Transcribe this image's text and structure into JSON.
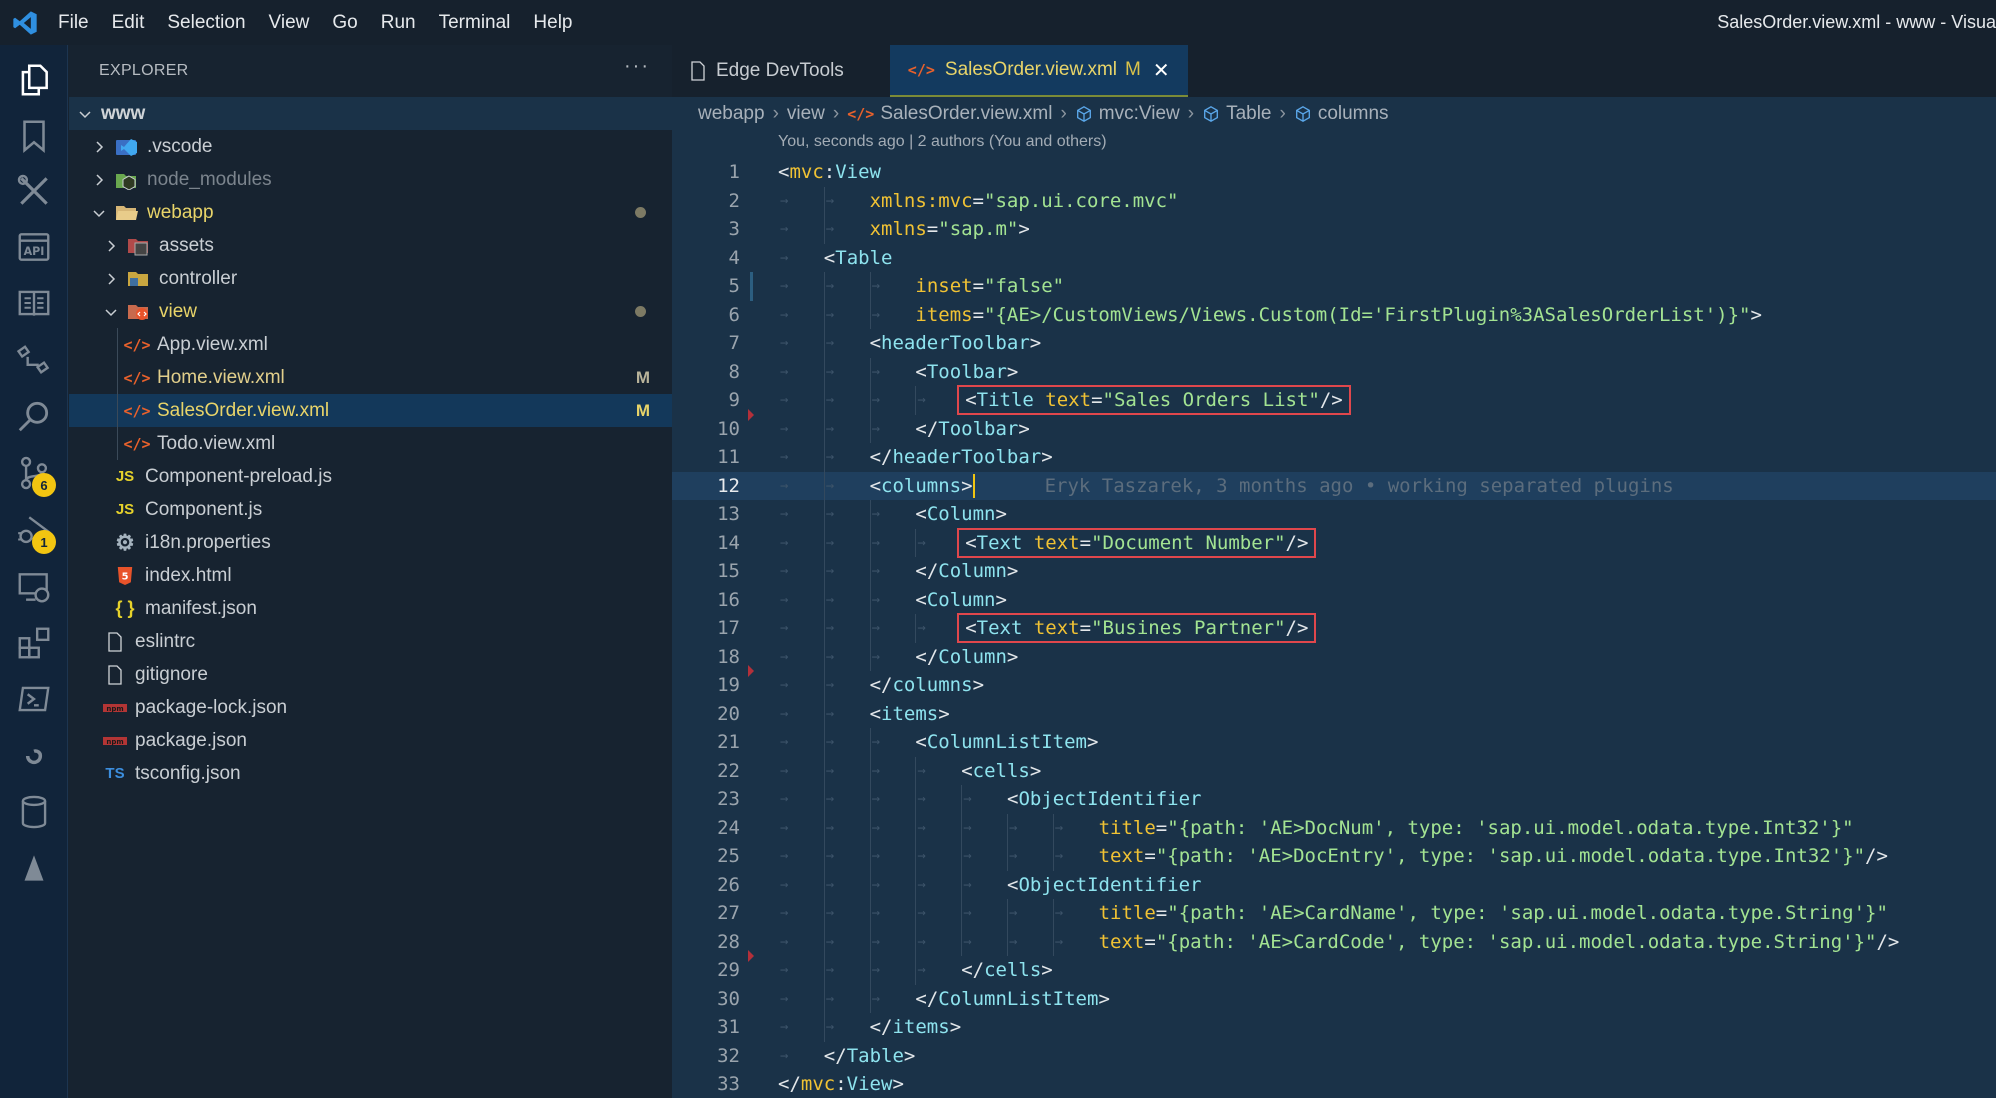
{
  "window": {
    "title": "SalesOrder.view.xml - www - Visual Studio Code",
    "title_visible": "SalesOrder.view.xml - www - Visua",
    "menu": [
      "File",
      "Edit",
      "Selection",
      "View",
      "Go",
      "Run",
      "Terminal",
      "Help"
    ]
  },
  "activity_bar": {
    "items": [
      {
        "name": "explorer",
        "icon": "files-icon",
        "active": true
      },
      {
        "name": "bookmarks",
        "icon": "bookmark-icon"
      },
      {
        "name": "sap-tools",
        "icon": "tools-icon"
      },
      {
        "name": "api",
        "icon": "api-icon"
      },
      {
        "name": "docs",
        "icon": "book-icon"
      },
      {
        "name": "remote-explorer",
        "icon": "remote-icon"
      },
      {
        "name": "search",
        "icon": "search-icon"
      },
      {
        "name": "source-control",
        "icon": "source-control-icon",
        "badge": "6"
      },
      {
        "name": "run-debug",
        "icon": "run-debug-icon",
        "badge": "1"
      },
      {
        "name": "remote-desktop",
        "icon": "remote-desktop-icon"
      },
      {
        "name": "extensions",
        "icon": "extensions-icon"
      },
      {
        "name": "powershell",
        "icon": "terminal-icon"
      },
      {
        "name": "swirl",
        "icon": "swirl-icon"
      },
      {
        "name": "database",
        "icon": "database-icon"
      },
      {
        "name": "azure",
        "icon": "azure-icon"
      }
    ]
  },
  "explorer": {
    "title": "EXPLORER",
    "more": "···",
    "root": "www",
    "items": [
      {
        "label": ".vscode",
        "type": "folder",
        "collapsed": true,
        "depth": 1,
        "icon": "vscode-folder-icon"
      },
      {
        "label": "node_modules",
        "type": "folder",
        "collapsed": true,
        "depth": 1,
        "icon": "node-folder-icon",
        "dim": true
      },
      {
        "label": "webapp",
        "type": "folder",
        "collapsed": false,
        "depth": 1,
        "icon": "folder-open-icon",
        "dot": true,
        "modified_color": true
      },
      {
        "label": "assets",
        "type": "folder",
        "collapsed": true,
        "depth": 2,
        "icon": "assets-folder-icon"
      },
      {
        "label": "controller",
        "type": "folder",
        "collapsed": true,
        "depth": 2,
        "icon": "controller-folder-icon"
      },
      {
        "label": "view",
        "type": "folder",
        "collapsed": false,
        "depth": 2,
        "icon": "view-folder-icon",
        "dot": true,
        "modified_color": true
      },
      {
        "label": "App.view.xml",
        "type": "file",
        "depth": 3,
        "icon": "xml-icon"
      },
      {
        "label": "Home.view.xml",
        "type": "file",
        "depth": 3,
        "icon": "xml-icon",
        "status": "M"
      },
      {
        "label": "SalesOrder.view.xml",
        "type": "file",
        "depth": 3,
        "icon": "xml-icon",
        "status": "M",
        "selected": true
      },
      {
        "label": "Todo.view.xml",
        "type": "file",
        "depth": 3,
        "icon": "xml-icon"
      },
      {
        "label": "Component-preload.js",
        "type": "file",
        "depth": 2,
        "icon": "js-icon"
      },
      {
        "label": "Component.js",
        "type": "file",
        "depth": 2,
        "icon": "js-icon"
      },
      {
        "label": "i18n.properties",
        "type": "file",
        "depth": 2,
        "icon": "gear-icon"
      },
      {
        "label": "index.html",
        "type": "file",
        "depth": 2,
        "icon": "html5-icon"
      },
      {
        "label": "manifest.json",
        "type": "file",
        "depth": 2,
        "icon": "json-icon"
      },
      {
        "label": "eslintrc",
        "type": "file",
        "depth": 1,
        "icon": "file-icon"
      },
      {
        "label": "gitignore",
        "type": "file",
        "depth": 1,
        "icon": "file-icon"
      },
      {
        "label": "package-lock.json",
        "type": "file",
        "depth": 1,
        "icon": "npm-icon"
      },
      {
        "label": "package.json",
        "type": "file",
        "depth": 1,
        "icon": "npm-icon"
      },
      {
        "label": "tsconfig.json",
        "type": "file",
        "depth": 1,
        "icon": "tsconfig-icon"
      }
    ]
  },
  "tabs": [
    {
      "label": "Edge DevTools",
      "icon": "file-icon",
      "active": false
    },
    {
      "label": "SalesOrder.view.xml",
      "icon": "xml-icon",
      "active": true,
      "status": "M",
      "close": "✕"
    }
  ],
  "breadcrumb": [
    {
      "label": "webapp"
    },
    {
      "label": "view"
    },
    {
      "label": "SalesOrder.view.xml",
      "icon": "xml-icon"
    },
    {
      "label": "mvc:View",
      "icon": "symbol-icon"
    },
    {
      "label": "Table",
      "icon": "symbol-icon"
    },
    {
      "label": "columns",
      "icon": "symbol-icon"
    }
  ],
  "codelens": "You, seconds ago | 2 authors (You and others)",
  "editor": {
    "current_line": 12,
    "blame": "Eryk Taszarek, 3 months ago • working separated plugins",
    "lines": [
      {
        "n": "1",
        "indent": 0,
        "tokens": [
          [
            "p",
            "<"
          ],
          [
            "ns",
            "mvc"
          ],
          [
            "p",
            ":"
          ],
          [
            "tag",
            "View"
          ]
        ]
      },
      {
        "n": "2",
        "indent": 2,
        "tokens": [
          [
            "attr",
            "xmlns:mvc"
          ],
          [
            "p",
            "="
          ],
          [
            "str",
            "\"sap.ui.core.mvc\""
          ]
        ]
      },
      {
        "n": "3",
        "indent": 2,
        "tokens": [
          [
            "attr",
            "xmlns"
          ],
          [
            "p",
            "="
          ],
          [
            "str",
            "\"sap.m\""
          ],
          [
            "p",
            ">"
          ]
        ]
      },
      {
        "n": "4",
        "indent": 1,
        "tokens": [
          [
            "p",
            "<"
          ],
          [
            "tag",
            "Table"
          ]
        ]
      },
      {
        "n": "5",
        "indent": 3,
        "tokens": [
          [
            "attr",
            "inset"
          ],
          [
            "p",
            "="
          ],
          [
            "str",
            "\"false\""
          ]
        ]
      },
      {
        "n": "6",
        "indent": 3,
        "tokens": [
          [
            "attr",
            "items"
          ],
          [
            "p",
            "="
          ],
          [
            "str",
            "\"{AE>/CustomViews/Views.Custom(Id='FirstPlugin%3ASalesOrderList')}\""
          ],
          [
            "p",
            ">"
          ]
        ]
      },
      {
        "n": "7",
        "indent": 2,
        "tokens": [
          [
            "p",
            "<"
          ],
          [
            "tag",
            "headerToolbar"
          ],
          [
            "p",
            ">"
          ]
        ]
      },
      {
        "n": "8",
        "indent": 3,
        "tokens": [
          [
            "p",
            "<"
          ],
          [
            "tag",
            "Toolbar"
          ],
          [
            "p",
            ">"
          ]
        ]
      },
      {
        "n": "9",
        "indent": 4,
        "highlight": true,
        "tokens": [
          [
            "p",
            "<"
          ],
          [
            "tag",
            "Title"
          ],
          [
            "p",
            " "
          ],
          [
            "attr",
            "text"
          ],
          [
            "p",
            "="
          ],
          [
            "str",
            "\"Sales Orders List\""
          ],
          [
            "p",
            "/>"
          ]
        ]
      },
      {
        "n": "10",
        "indent": 3,
        "tokens": [
          [
            "p",
            "</"
          ],
          [
            "tag",
            "Toolbar"
          ],
          [
            "p",
            ">"
          ]
        ]
      },
      {
        "n": "11",
        "indent": 2,
        "tokens": [
          [
            "p",
            "</"
          ],
          [
            "tag",
            "headerToolbar"
          ],
          [
            "p",
            ">"
          ]
        ]
      },
      {
        "n": "12",
        "indent": 2,
        "cursor": true,
        "tokens": [
          [
            "p",
            "<"
          ],
          [
            "tag",
            "columns"
          ],
          [
            "p",
            ">"
          ]
        ]
      },
      {
        "n": "13",
        "indent": 3,
        "tokens": [
          [
            "p",
            "<"
          ],
          [
            "tag",
            "Column"
          ],
          [
            "p",
            ">"
          ]
        ]
      },
      {
        "n": "14",
        "indent": 4,
        "highlight": true,
        "tokens": [
          [
            "p",
            "<"
          ],
          [
            "tag",
            "Text"
          ],
          [
            "p",
            " "
          ],
          [
            "attr",
            "text"
          ],
          [
            "p",
            "="
          ],
          [
            "str",
            "\"Document Number\""
          ],
          [
            "p",
            "/>"
          ]
        ]
      },
      {
        "n": "15",
        "indent": 3,
        "tokens": [
          [
            "p",
            "</"
          ],
          [
            "tag",
            "Column"
          ],
          [
            "p",
            ">"
          ]
        ]
      },
      {
        "n": "16",
        "indent": 3,
        "tokens": [
          [
            "p",
            "<"
          ],
          [
            "tag",
            "Column"
          ],
          [
            "p",
            ">"
          ]
        ]
      },
      {
        "n": "17",
        "indent": 4,
        "highlight": true,
        "tokens": [
          [
            "p",
            "<"
          ],
          [
            "tag",
            "Text"
          ],
          [
            "p",
            " "
          ],
          [
            "attr",
            "text"
          ],
          [
            "p",
            "="
          ],
          [
            "str",
            "\"Busines Partner\""
          ],
          [
            "p",
            "/>"
          ]
        ]
      },
      {
        "n": "18",
        "indent": 3,
        "tokens": [
          [
            "p",
            "</"
          ],
          [
            "tag",
            "Column"
          ],
          [
            "p",
            ">"
          ]
        ]
      },
      {
        "n": "19",
        "indent": 2,
        "tokens": [
          [
            "p",
            "</"
          ],
          [
            "tag",
            "columns"
          ],
          [
            "p",
            ">"
          ]
        ]
      },
      {
        "n": "20",
        "indent": 2,
        "tokens": [
          [
            "p",
            "<"
          ],
          [
            "tag",
            "items"
          ],
          [
            "p",
            ">"
          ]
        ]
      },
      {
        "n": "21",
        "indent": 3,
        "tokens": [
          [
            "p",
            "<"
          ],
          [
            "tag",
            "ColumnListItem"
          ],
          [
            "p",
            ">"
          ]
        ]
      },
      {
        "n": "22",
        "indent": 4,
        "tokens": [
          [
            "p",
            "<"
          ],
          [
            "tag",
            "cells"
          ],
          [
            "p",
            ">"
          ]
        ]
      },
      {
        "n": "23",
        "indent": 5,
        "tokens": [
          [
            "p",
            "<"
          ],
          [
            "tag",
            "ObjectIdentifier"
          ]
        ]
      },
      {
        "n": "24",
        "indent": 7,
        "tokens": [
          [
            "attr",
            "title"
          ],
          [
            "p",
            "="
          ],
          [
            "str",
            "\"{path: 'AE>DocNum', type: 'sap.ui.model.odata.type.Int32'}\""
          ]
        ]
      },
      {
        "n": "25",
        "indent": 7,
        "tokens": [
          [
            "attr",
            "text"
          ],
          [
            "p",
            "="
          ],
          [
            "str",
            "\"{path: 'AE>DocEntry', type: 'sap.ui.model.odata.type.Int32'}\""
          ],
          [
            "p",
            "/>"
          ]
        ]
      },
      {
        "n": "26",
        "indent": 5,
        "tokens": [
          [
            "p",
            "<"
          ],
          [
            "tag",
            "ObjectIdentifier"
          ]
        ]
      },
      {
        "n": "27",
        "indent": 7,
        "tokens": [
          [
            "attr",
            "title"
          ],
          [
            "p",
            "="
          ],
          [
            "str",
            "\"{path: 'AE>CardName', type: 'sap.ui.model.odata.type.String'}\""
          ]
        ]
      },
      {
        "n": "28",
        "indent": 7,
        "tokens": [
          [
            "attr",
            "text"
          ],
          [
            "p",
            "="
          ],
          [
            "str",
            "\"{path: 'AE>CardCode', type: 'sap.ui.model.odata.type.String'}\""
          ],
          [
            "p",
            "/>"
          ]
        ]
      },
      {
        "n": "29",
        "indent": 4,
        "tokens": [
          [
            "p",
            "</"
          ],
          [
            "tag",
            "cells"
          ],
          [
            "p",
            ">"
          ]
        ]
      },
      {
        "n": "30",
        "indent": 3,
        "tokens": [
          [
            "p",
            "</"
          ],
          [
            "tag",
            "ColumnListItem"
          ],
          [
            "p",
            ">"
          ]
        ]
      },
      {
        "n": "31",
        "indent": 2,
        "tokens": [
          [
            "p",
            "</"
          ],
          [
            "tag",
            "items"
          ],
          [
            "p",
            ">"
          ]
        ]
      },
      {
        "n": "32",
        "indent": 1,
        "tokens": [
          [
            "p",
            "</"
          ],
          [
            "tag",
            "Table"
          ],
          [
            "p",
            ">"
          ]
        ]
      },
      {
        "n": "33",
        "indent": 0,
        "tokens": [
          [
            "p",
            "</"
          ],
          [
            "ns",
            "mvc"
          ],
          [
            "p",
            ":"
          ],
          [
            "tag",
            "View"
          ],
          [
            "p",
            ">"
          ]
        ]
      }
    ]
  },
  "colors": {
    "accent_badge": "#f2c511",
    "highlight_box": "#e0474c",
    "modified": "#e8d469",
    "string": "#a3e392",
    "tag": "#8ee3ee",
    "attribute": "#f0c234"
  }
}
